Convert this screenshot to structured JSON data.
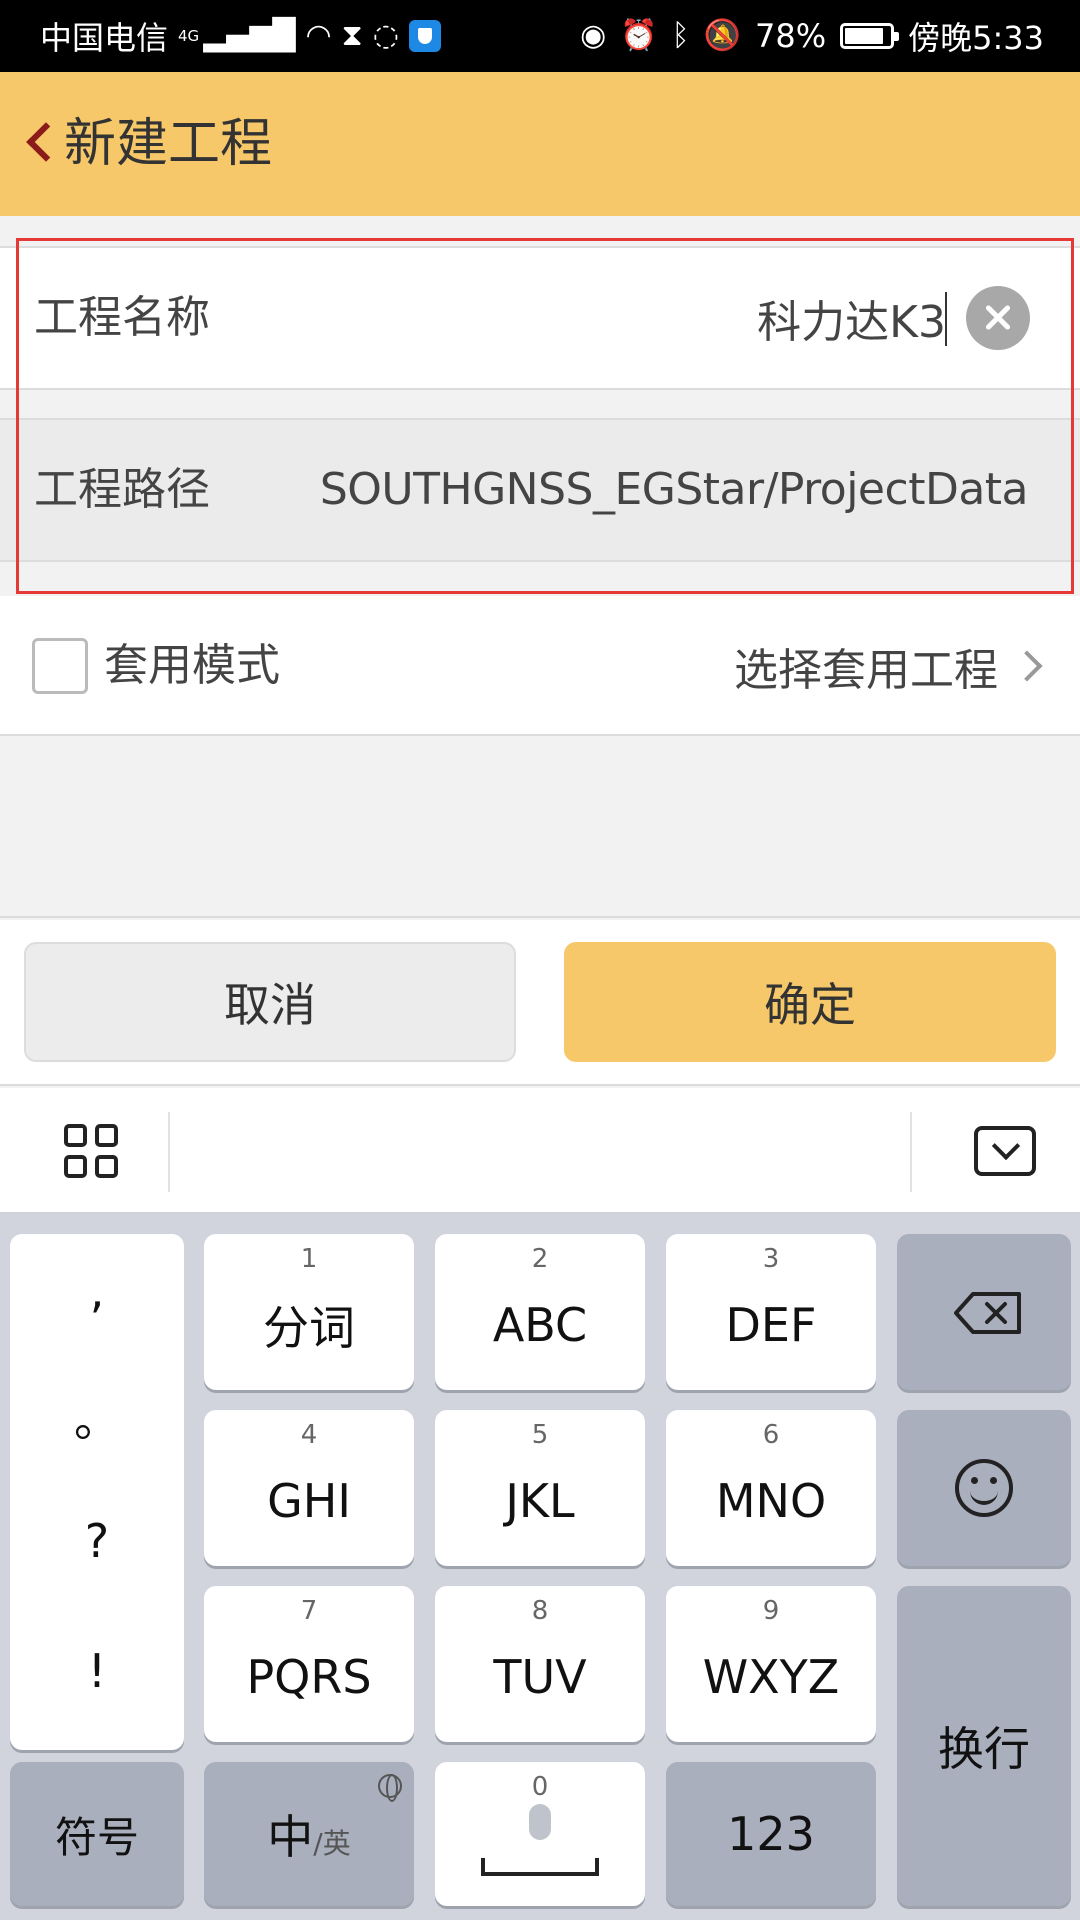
{
  "status_bar": {
    "carrier": "中国电信",
    "network": "4G",
    "battery": "78%",
    "time": "傍晚5:33"
  },
  "app_bar": {
    "title": "新建工程"
  },
  "form": {
    "name_label": "工程名称",
    "name_value": "科力达K3",
    "path_label": "工程路径",
    "path_value": "SOUTHGNSS_EGStar/ProjectData",
    "mode_label": "套用模式",
    "select_label": "选择套用工程"
  },
  "buttons": {
    "cancel": "取消",
    "confirm": "确定"
  },
  "keyboard": {
    "punct": [
      ",",
      "。",
      "?",
      "!"
    ],
    "keys": [
      {
        "num": "1",
        "label": "分词"
      },
      {
        "num": "2",
        "label": "ABC"
      },
      {
        "num": "3",
        "label": "DEF"
      },
      {
        "num": "4",
        "label": "GHI"
      },
      {
        "num": "5",
        "label": "JKL"
      },
      {
        "num": "6",
        "label": "MNO"
      },
      {
        "num": "7",
        "label": "PQRS"
      },
      {
        "num": "8",
        "label": "TUV"
      },
      {
        "num": "9",
        "label": "WXYZ"
      }
    ],
    "symbols": "符号",
    "lang_main": "中",
    "lang_alt": "/英",
    "space_num": "0",
    "digits": "123",
    "enter": "换行"
  },
  "colors": {
    "accent": "#f6c86a",
    "back_arrow": "#8b1a1a",
    "highlight": "#e53935"
  }
}
